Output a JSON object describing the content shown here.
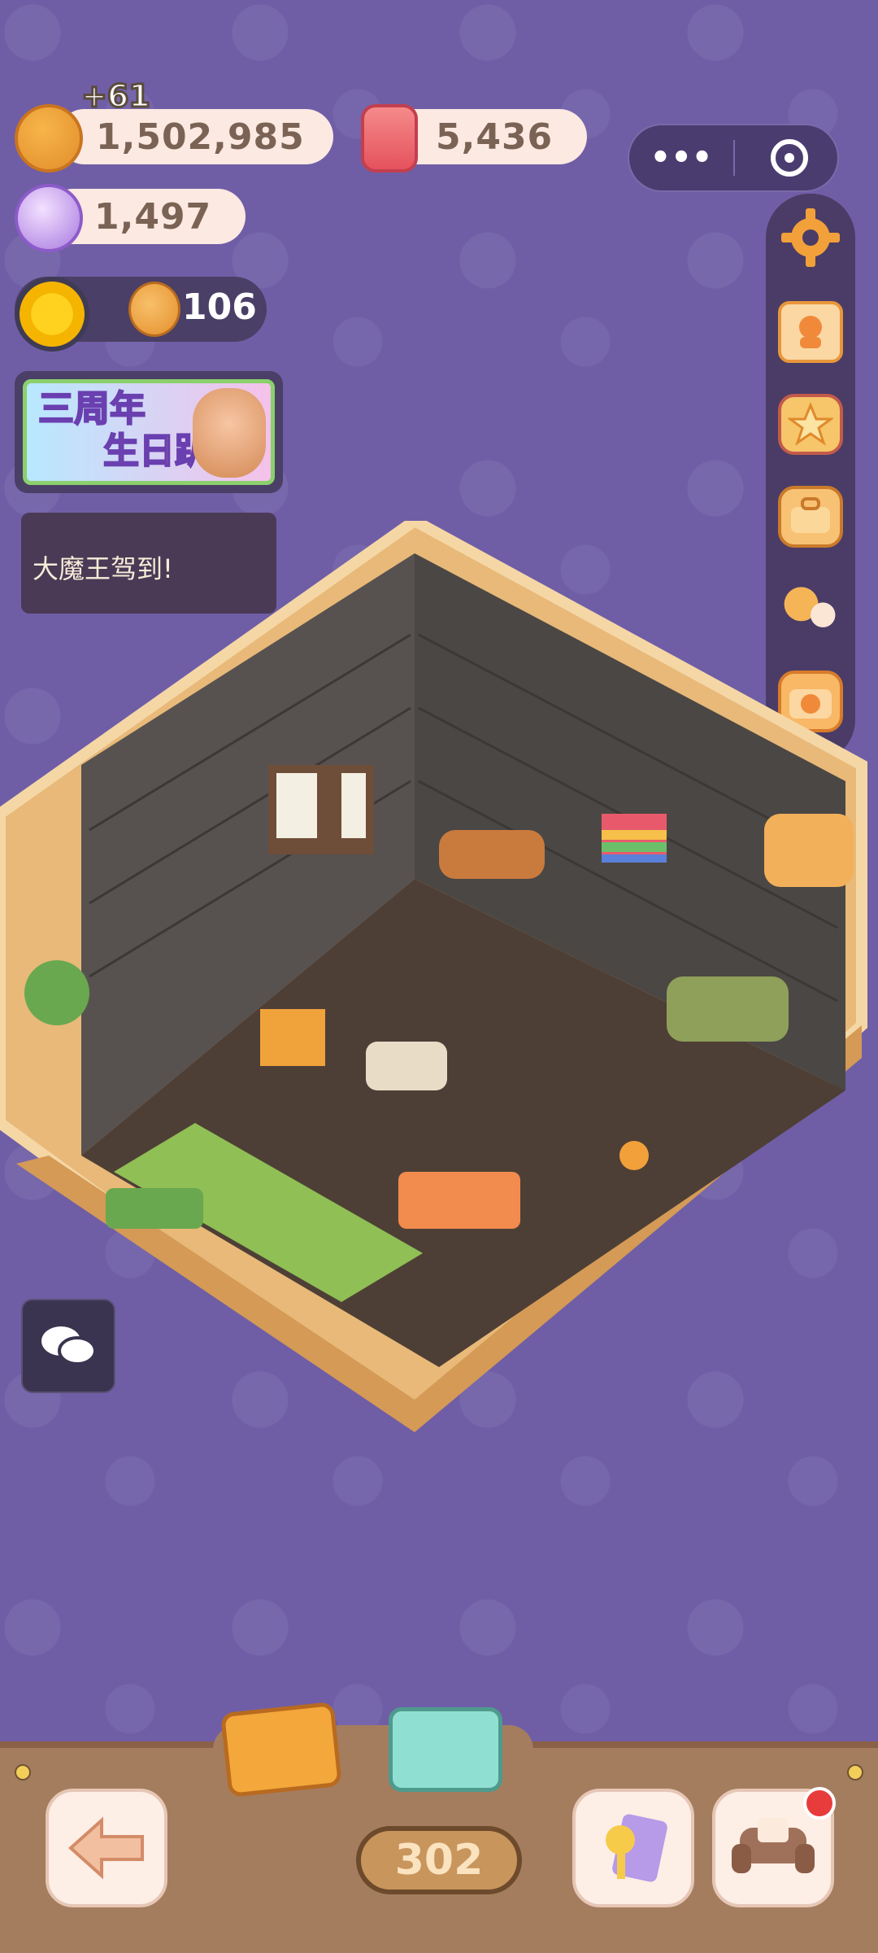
{
  "resources": {
    "cookies": "1,502,985",
    "cookies_bonus": "+61",
    "candles": "5,436",
    "gems": "1,497",
    "sun_helpers": "106"
  },
  "banner": {
    "title_line1": "三周年",
    "title_line2": "生日趴"
  },
  "toast": {
    "message": "大魔王驾到!"
  },
  "capsule": {
    "more": "•••"
  },
  "side_menu": [
    {
      "icon": "gear-icon"
    },
    {
      "icon": "stamp-icon"
    },
    {
      "icon": "star-shop-icon"
    },
    {
      "icon": "bag-icon"
    },
    {
      "icon": "friends-icon"
    },
    {
      "icon": "camera-icon"
    }
  ],
  "bottom": {
    "level": "302"
  },
  "colors": {
    "background": "#6f5ea6",
    "bar": "#a47d5f",
    "accent": "#f2a03a"
  }
}
